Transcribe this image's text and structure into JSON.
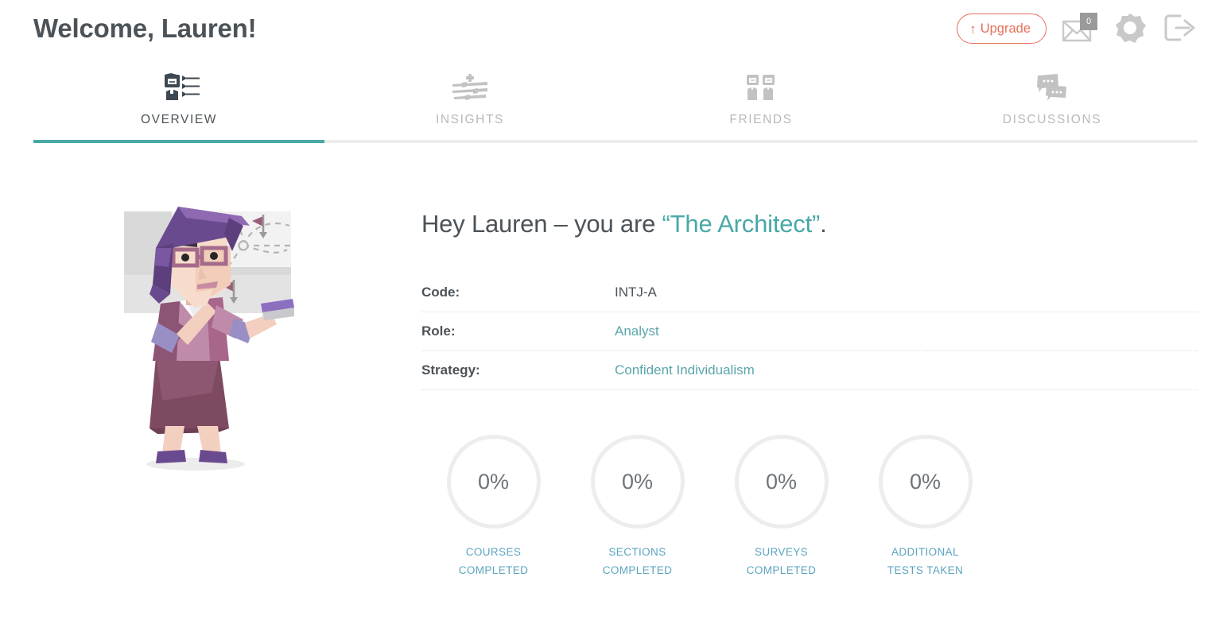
{
  "header": {
    "title": "Welcome, Lauren!",
    "upgrade_label": "Upgrade",
    "upgrade_arrow": "↑",
    "upgrade_color": "#e8705a",
    "mail_badge_count": "0",
    "mail_icon": "envelope-icon",
    "settings_icon": "gear-icon",
    "logout_icon": "logout-icon"
  },
  "tabs": [
    {
      "label": "OVERVIEW",
      "icon": "profile-arrows-icon",
      "active": true
    },
    {
      "label": "INSIGHTS",
      "icon": "sliders-icon",
      "active": false
    },
    {
      "label": "FRIENDS",
      "icon": "two-people-icon",
      "active": false
    },
    {
      "label": "DISCUSSIONS",
      "icon": "speech-bubbles-icon",
      "active": false
    }
  ],
  "active_tab_color": "#49a8a8",
  "main": {
    "illustration_alt": "architect-character-illustration",
    "greeting_prefix": "Hey Lauren – you are ",
    "greeting_type": "“The Architect”",
    "greeting_suffix": ".",
    "info_rows": [
      {
        "label": "Code:",
        "value": "INTJ-A",
        "is_link": false
      },
      {
        "label": "Role:",
        "value": "Analyst",
        "is_link": true
      },
      {
        "label": "Strategy:",
        "value": "Confident Individualism",
        "is_link": true
      }
    ],
    "stats": [
      {
        "percent": "0%",
        "label": "COURSES\nCOMPLETED"
      },
      {
        "percent": "0%",
        "label": "SECTIONS\nCOMPLETED"
      },
      {
        "percent": "0%",
        "label": "SURVEYS\nCOMPLETED"
      },
      {
        "percent": "0%",
        "label": "ADDITIONAL\nTESTS TAKEN"
      }
    ]
  },
  "colors": {
    "teal": "#49a8a8",
    "link_teal": "#5aa5ab",
    "stat_label": "#5ba4c0",
    "accent_orange": "#e8705a",
    "text_dark": "#4c5358"
  }
}
